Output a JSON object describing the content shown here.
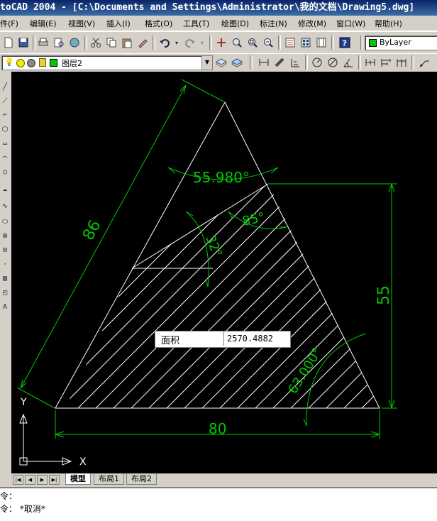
{
  "window": {
    "title": "toCAD 2004 - [C:\\Documents and Settings\\Administrator\\我的文档\\Drawing5.dwg]"
  },
  "menu": {
    "items": [
      "件(F)",
      "编辑(E)",
      "视图(V)",
      "插入(I)",
      "格式(O)",
      "工具(T)",
      "绘图(D)",
      "标注(N)",
      "修改(M)",
      "窗口(W)",
      "帮助(H)"
    ]
  },
  "properties": {
    "color_value": "ByLayer"
  },
  "layers": {
    "current_layer": "图层2"
  },
  "drawing": {
    "dim_angle_top": "55.980°",
    "dim_angle_mid": "85°",
    "dim_angle_inner": "32°",
    "dim_length_side": "86",
    "dim_length_height": "55",
    "dim_length_base": "80",
    "dim_angle_bottom": "63.000°",
    "ucs_y": "Y",
    "ucs_x": "X"
  },
  "area_box": {
    "label": "面积",
    "value": "2570.4882"
  },
  "tabs": {
    "items": [
      "模型",
      "布局1",
      "布局2"
    ],
    "active": "模型"
  },
  "command": {
    "line1": "令：",
    "line2": "令： *取消*"
  },
  "colors": {
    "geometry": "#ffffff",
    "dimensions": "#00c800",
    "canvas": "#000000"
  },
  "icons": {
    "toolbar": [
      "new-icon",
      "save-icon",
      "print-icon",
      "preview-icon",
      "publish-icon",
      "cut-icon",
      "copy-icon",
      "paste-icon",
      "matchprop-icon",
      "undo-icon",
      "redo-icon",
      "pan-icon",
      "zoom-realtime-icon",
      "zoom-window-icon",
      "zoom-previous-icon",
      "properties-icon",
      "designcenter-icon",
      "toolpalette-icon",
      "help-icon"
    ]
  }
}
